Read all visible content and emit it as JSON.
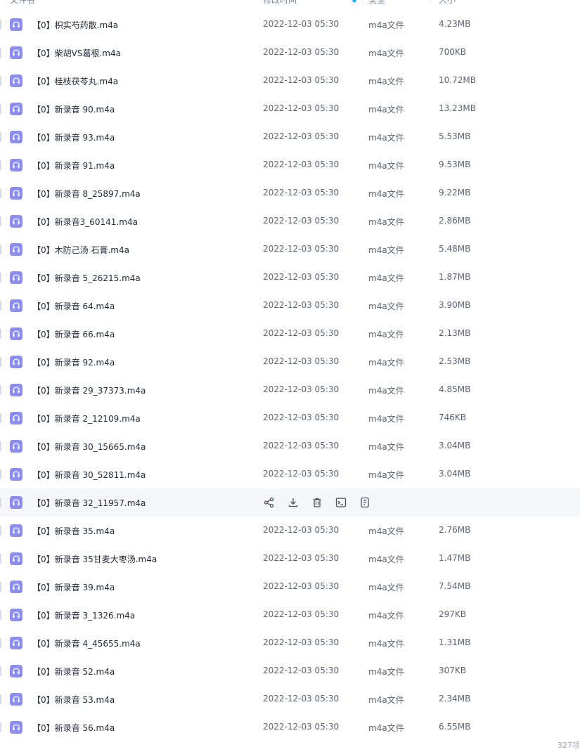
{
  "header": {
    "name_label": "文件名",
    "date_label": "修改时间",
    "type_label": "类型",
    "size_label": "大小"
  },
  "files": [
    {
      "name": "【0】枳实芍药散.m4a",
      "date": "2022-12-03 05:30",
      "type": "m4a文件",
      "size": "4.23MB"
    },
    {
      "name": "【0】柴胡VS葛根.m4a",
      "date": "2022-12-03 05:30",
      "type": "m4a文件",
      "size": "700KB"
    },
    {
      "name": "【0】桂枝茯苓丸.m4a",
      "date": "2022-12-03 05:30",
      "type": "m4a文件",
      "size": "10.72MB"
    },
    {
      "name": "【0】新录音 90.m4a",
      "date": "2022-12-03 05:30",
      "type": "m4a文件",
      "size": "13.23MB"
    },
    {
      "name": "【0】新录音 93.m4a",
      "date": "2022-12-03 05:30",
      "type": "m4a文件",
      "size": "5.53MB"
    },
    {
      "name": "【0】新录音 91.m4a",
      "date": "2022-12-03 05:30",
      "type": "m4a文件",
      "size": "9.53MB"
    },
    {
      "name": "【0】新录音 8_25897.m4a",
      "date": "2022-12-03 05:30",
      "type": "m4a文件",
      "size": "9.22MB"
    },
    {
      "name": "【0】新录音3_60141.m4a",
      "date": "2022-12-03 05:30",
      "type": "m4a文件",
      "size": "2.86MB"
    },
    {
      "name": "【0】木防己汤 石膏.m4a",
      "date": "2022-12-03 05:30",
      "type": "m4a文件",
      "size": "5.48MB"
    },
    {
      "name": "【0】新录音 5_26215.m4a",
      "date": "2022-12-03 05:30",
      "type": "m4a文件",
      "size": "1.87MB"
    },
    {
      "name": "【0】新录音 64.m4a",
      "date": "2022-12-03 05:30",
      "type": "m4a文件",
      "size": "3.90MB"
    },
    {
      "name": "【0】新录音 66.m4a",
      "date": "2022-12-03 05:30",
      "type": "m4a文件",
      "size": "2.13MB"
    },
    {
      "name": "【0】新录音 92.m4a",
      "date": "2022-12-03 05:30",
      "type": "m4a文件",
      "size": "2.53MB"
    },
    {
      "name": "【0】新录音 29_37373.m4a",
      "date": "2022-12-03 05:30",
      "type": "m4a文件",
      "size": "4.85MB"
    },
    {
      "name": "【0】新录音 2_12109.m4a",
      "date": "2022-12-03 05:30",
      "type": "m4a文件",
      "size": "746KB"
    },
    {
      "name": "【0】新录音 30_15665.m4a",
      "date": "2022-12-03 05:30",
      "type": "m4a文件",
      "size": "3.04MB"
    },
    {
      "name": "【0】新录音 30_52811.m4a",
      "date": "2022-12-03 05:30",
      "type": "m4a文件",
      "size": "3.04MB"
    },
    {
      "name": "【0】新录音 32_11957.m4a",
      "hover": true
    },
    {
      "name": "【0】新录音 35.m4a",
      "date": "2022-12-03 05:30",
      "type": "m4a文件",
      "size": "2.76MB"
    },
    {
      "name": "【0】新录音 35甘麦大枣汤.m4a",
      "date": "2022-12-03 05:30",
      "type": "m4a文件",
      "size": "1.47MB"
    },
    {
      "name": "【0】新录音 39.m4a",
      "date": "2022-12-03 05:30",
      "type": "m4a文件",
      "size": "7.54MB"
    },
    {
      "name": "【0】新录音 3_1326.m4a",
      "date": "2022-12-03 05:30",
      "type": "m4a文件",
      "size": "297KB"
    },
    {
      "name": "【0】新录音 4_45655.m4a",
      "date": "2022-12-03 05:30",
      "type": "m4a文件",
      "size": "1.31MB"
    },
    {
      "name": "【0】新录音 52.m4a",
      "date": "2022-12-03 05:30",
      "type": "m4a文件",
      "size": "307KB"
    },
    {
      "name": "【0】新录音 53.m4a",
      "date": "2022-12-03 05:30",
      "type": "m4a文件",
      "size": "2.34MB"
    },
    {
      "name": "【0】新录音 56.m4a",
      "date": "2022-12-03 05:30",
      "type": "m4a文件",
      "size": "6.55MB"
    }
  ],
  "row_actions": [
    {
      "icon": "share-icon"
    },
    {
      "icon": "download-icon"
    },
    {
      "icon": "delete-icon"
    },
    {
      "icon": "move-to-icon"
    },
    {
      "icon": "more-icon"
    }
  ],
  "footer": {
    "count_label": "327项"
  },
  "colors": {
    "audio_icon_bg": "#8d8cf0",
    "sort_accent": "#06a7ff",
    "hover_row_bg": "#f6f7fb"
  }
}
